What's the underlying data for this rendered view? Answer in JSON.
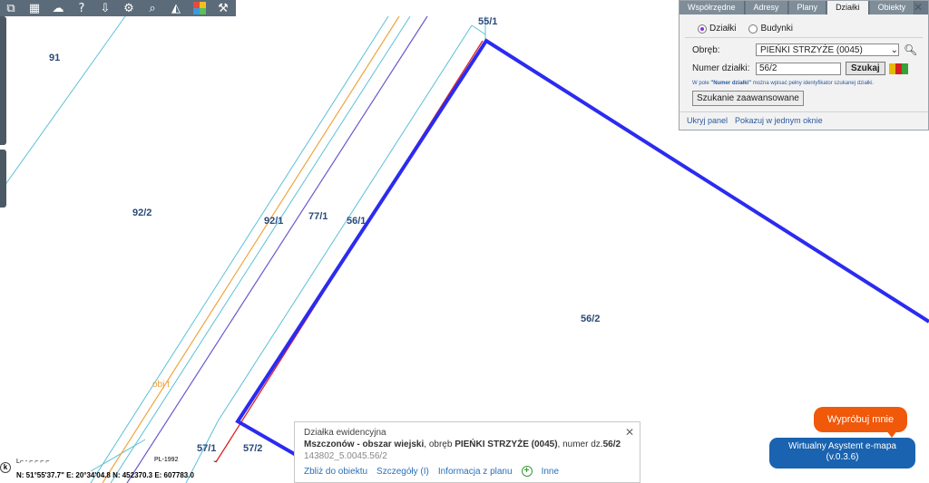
{
  "toolbar": {
    "icons": [
      "layers-icon",
      "grid-icon",
      "map-icon",
      "help-icon",
      "cloud-download-icon",
      "settings-icon",
      "zoom-icon",
      "measure-icon",
      "palette-icon",
      "tools-icon"
    ]
  },
  "map": {
    "parcels": {
      "p91": "91",
      "p92_2": "92/2",
      "p92_1": "92/1",
      "p77_1": "77/1",
      "p56_1": "56/1",
      "p55_1": "55/1",
      "p56_2": "56/2",
      "p57_1": "57/1",
      "p57_2": "57/2",
      "p_obj": "obj t"
    },
    "colors": {
      "highlight": "#2b2bf0",
      "parcel_line": "#5bc0d6",
      "orange_line": "#f0a540",
      "purple_line": "#6a5acd",
      "red_line": "#e02020",
      "label": "#2a4a7a"
    }
  },
  "search_panel": {
    "tabs": [
      "Współrzędne",
      "Adresy",
      "Plany",
      "Działki",
      "Obiekty"
    ],
    "active_tab": "Działki",
    "radio_dzialki": "Działki",
    "radio_budynki": "Budynki",
    "obreb_label": "Obręb:",
    "obreb_value": "PIEŃKI STRZYŻE (0045)",
    "numer_label": "Numer działki:",
    "numer_value": "56/2",
    "search_button": "Szukaj",
    "hint_prefix": "W pole ",
    "hint_bold": "\"Numer działki\"",
    "hint_suffix": " można wpisać pełny identyfikator szukanej działki.",
    "advanced_button": "Szukanie zaawansowane",
    "hide_link": "Ukryj panel",
    "show_window_link": "Pokazuj w jednym oknie",
    "color_blocks": [
      "#e8b800",
      "#d62020",
      "#3aa03a"
    ]
  },
  "info_popup": {
    "title": "Działka ewidencyjna",
    "place": "Mszczonów - obszar wiejski",
    "obreb_prefix": ", obręb ",
    "obreb": "PIEŃKI STRZYŻE (0045)",
    "numer_prefix": ", numer dz.",
    "numer": "56/2",
    "code": "143802_5.0045.56/2",
    "links": [
      "Zbliż do obiektu",
      "Szczegóły (I)",
      "Informacja z planu",
      "Inne"
    ]
  },
  "status_bar": {
    "crs": "PL-1992",
    "coords": "N: 51°55'37.7\" E: 20°34'04.8   N: 452370.3   E: 607783.0",
    "scale_text": "L⌐ - ⌐ ⌐ ⌐ ⌐"
  },
  "assistant": {
    "try_label": "Wypróbuj mnie",
    "button_line1": "Wirtualny Asystent e-mapa",
    "button_line2": "(v.0.3.6)"
  }
}
